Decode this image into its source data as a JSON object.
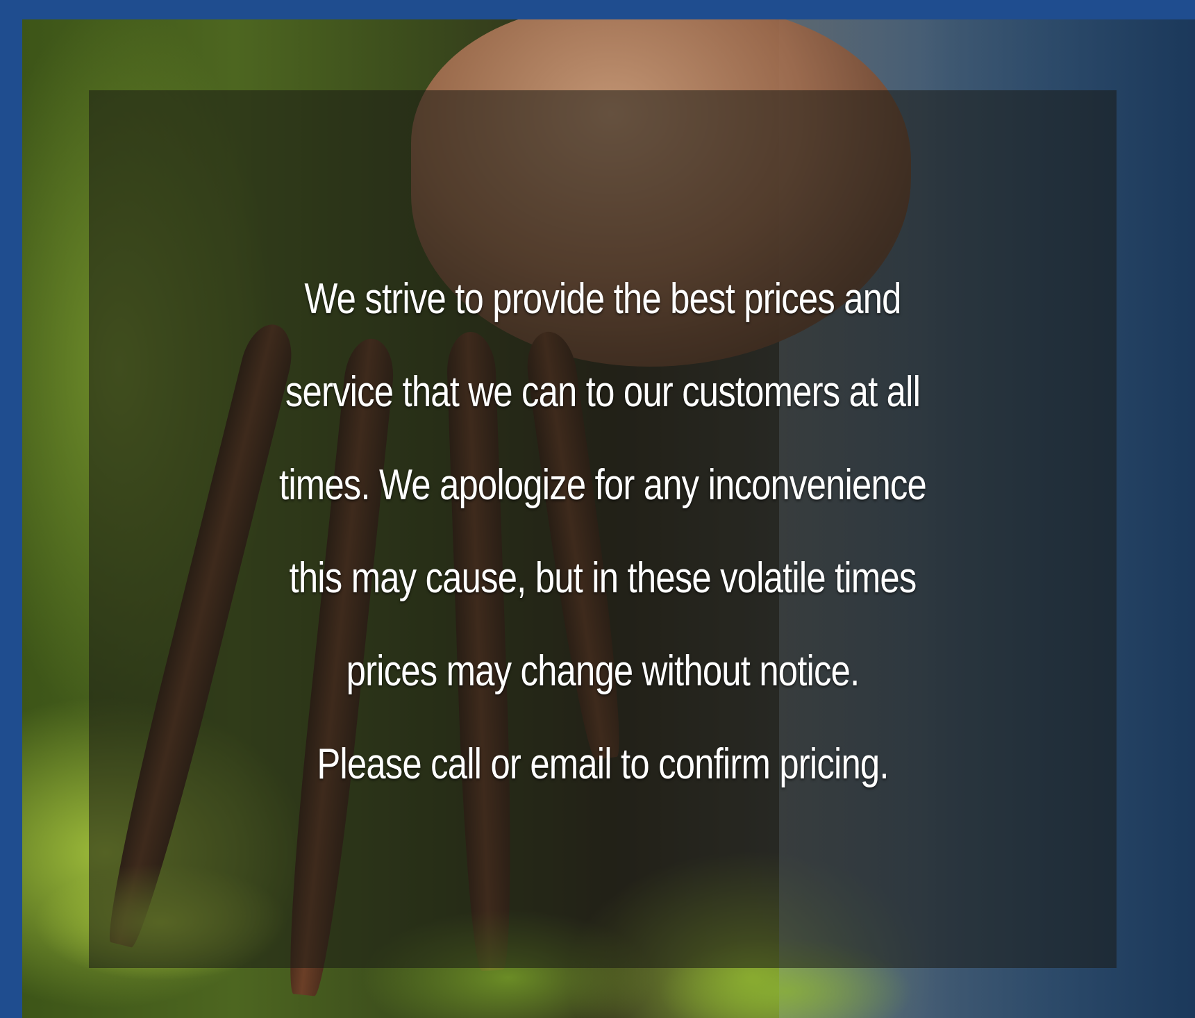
{
  "notice": {
    "lines": [
      "We strive to provide the best prices and",
      "service that we can to our customers at all",
      "times. We apologize for any inconvenience",
      "this may cause, but in these volatile times",
      "prices may change without notice.",
      "Please call or email to confirm pricing."
    ]
  },
  "colors": {
    "border": "#1f4d8f",
    "text": "#ffffff",
    "overlay": "rgba(25,25,20,0.55)"
  },
  "background_image": "hand-holding-carrots-photo"
}
